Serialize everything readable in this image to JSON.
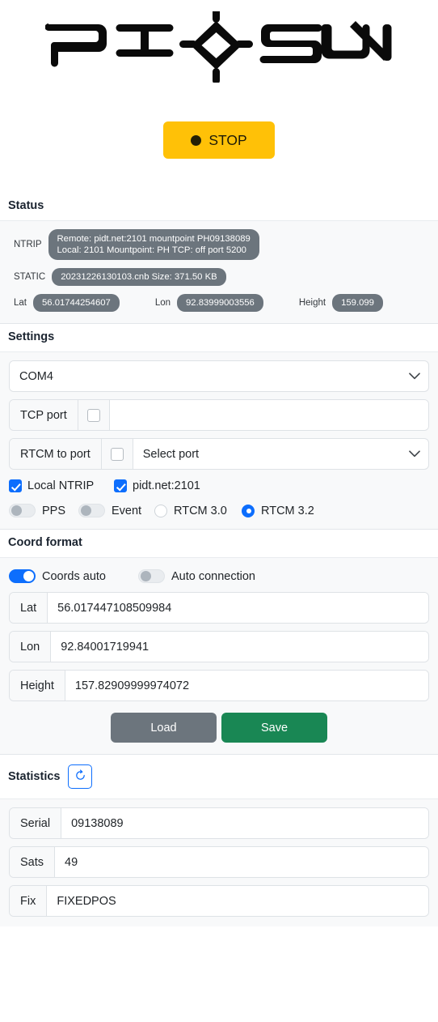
{
  "app": {
    "logo_text": "PI-◇-SUN",
    "logo_left": "PI",
    "logo_right": "SUN",
    "accent_amber": "#ffc107",
    "accent_blue": "#0d6efd",
    "accent_green": "#198754",
    "accent_grey": "#6c757d"
  },
  "stop_button": {
    "label": "STOP",
    "icon": "filled-circle-icon"
  },
  "status": {
    "title": "Status",
    "rows": [
      {
        "label": "NTRIP",
        "value": "Remote: pidt.net:2101 mountpoint PH09138089\nLocal: 2101 Mountpoint: PH TCP: off port 5200"
      },
      {
        "label": "STATIC",
        "value": "20231226130103.cnb Size: 371.50 KB"
      }
    ],
    "coords": [
      {
        "label": "Lat",
        "value": "56.01744254607"
      },
      {
        "label": "Lon",
        "value": "92.83999003556"
      },
      {
        "label": "Height",
        "value": "159.099"
      }
    ]
  },
  "settings": {
    "title": "Settings",
    "com_port": {
      "selected": "COM4",
      "icon": "chevron-down-icon"
    },
    "tcp_port": {
      "label": "TCP port",
      "checked": false,
      "value": ""
    },
    "rtcm_to_port": {
      "label": "RTCM to port",
      "checked": false,
      "selected": "Select port",
      "icon": "chevron-down-icon"
    },
    "checkboxes": [
      {
        "label": "Local NTRIP",
        "checked": true
      },
      {
        "label": "pidt.net:2101",
        "checked": true
      }
    ],
    "toggles": [
      {
        "label": "PPS",
        "on": false
      },
      {
        "label": "Event",
        "on": false
      }
    ],
    "radios": [
      {
        "label": "RTCM 3.0",
        "selected": false
      },
      {
        "label": "RTCM 3.2",
        "selected": true
      }
    ]
  },
  "coord_format": {
    "title": "Coord format",
    "toggles": [
      {
        "label": "Coords auto",
        "on": true
      },
      {
        "label": "Auto connection",
        "on": false
      }
    ],
    "fields": [
      {
        "label": "Lat",
        "value": "56.017447108509984"
      },
      {
        "label": "Lon",
        "value": "92.84001719941"
      },
      {
        "label": "Height",
        "value": "157.82909999974072"
      }
    ],
    "buttons": [
      {
        "label": "Load",
        "style": "grey"
      },
      {
        "label": "Save",
        "style": "green"
      }
    ]
  },
  "statistics": {
    "title": "Statistics",
    "refresh_icon": "refresh-icon",
    "fields": [
      {
        "label": "Serial",
        "value": "09138089"
      },
      {
        "label": "Sats",
        "value": "49"
      },
      {
        "label": "Fix",
        "value": "FIXEDPOS"
      }
    ]
  }
}
